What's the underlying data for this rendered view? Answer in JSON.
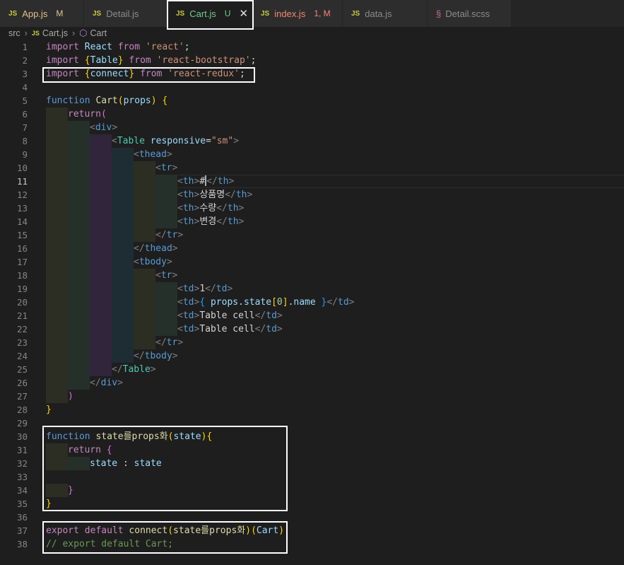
{
  "tabs": [
    {
      "icon": "JS",
      "label": "App.js",
      "badge": "M",
      "label_color": "#e2c08d",
      "badge_color": "#e2c08d"
    },
    {
      "icon": "JS",
      "label": "Detail.js",
      "badge": "",
      "label_color": "#8b8b8b",
      "badge_color": ""
    },
    {
      "icon": "JS",
      "label": "Cart.js",
      "badge": "U",
      "label_color": "#73c991",
      "badge_color": "#73c991",
      "active": true,
      "close": "✕"
    },
    {
      "icon": "JS",
      "label": "index.js",
      "badge": "1, M",
      "label_color": "#f48771",
      "badge_color": "#f48771"
    },
    {
      "icon": "JS",
      "label": "data.js",
      "badge": "",
      "label_color": "#8b8b8b",
      "badge_color": ""
    },
    {
      "icon": "sass-icon",
      "label": "Detail.scss",
      "badge": "",
      "label_color": "#8b8b8b",
      "badge_color": ""
    }
  ],
  "breadcrumb": {
    "folder": "src",
    "file_icon": "JS",
    "file": "Cart.js",
    "symbol_icon": "cube-icon",
    "symbol": "Cart"
  },
  "editor": {
    "current_line": 11,
    "lines": [
      {
        "n": "1",
        "indent": 0,
        "t": [
          [
            "import ",
            "kw"
          ],
          [
            "React ",
            "va"
          ],
          [
            "from ",
            "kw"
          ],
          [
            "'react'",
            "st"
          ],
          [
            ";",
            "txt"
          ]
        ]
      },
      {
        "n": "2",
        "indent": 0,
        "t": [
          [
            "import ",
            "kw"
          ],
          [
            "{",
            "br"
          ],
          [
            "Table",
            "va"
          ],
          [
            "} ",
            "br"
          ],
          [
            "from ",
            "kw"
          ],
          [
            "'react-bootstrap'",
            "st"
          ],
          [
            ";",
            "txt"
          ]
        ]
      },
      {
        "n": "3",
        "indent": 0,
        "t": [
          [
            "import ",
            "kw"
          ],
          [
            "{",
            "br"
          ],
          [
            "connect",
            "va"
          ],
          [
            "} ",
            "br"
          ],
          [
            "from ",
            "kw"
          ],
          [
            "'react-redux'",
            "st"
          ],
          [
            ";",
            "txt"
          ]
        ]
      },
      {
        "n": "4",
        "indent": 0,
        "t": []
      },
      {
        "n": "5",
        "indent": 0,
        "t": [
          [
            "function ",
            "dk"
          ],
          [
            "Cart",
            "fn"
          ],
          [
            "(",
            "br"
          ],
          [
            "props",
            "va"
          ],
          [
            ") ",
            "br"
          ],
          [
            "{",
            "br"
          ]
        ]
      },
      {
        "n": "6",
        "indent": 1,
        "t": [
          [
            "return",
            "kw"
          ],
          [
            "(",
            "bp"
          ]
        ]
      },
      {
        "n": "7",
        "indent": 2,
        "t": [
          [
            "<",
            "tg"
          ],
          [
            "div",
            "dk"
          ],
          [
            ">",
            "tg"
          ]
        ]
      },
      {
        "n": "8",
        "indent": 3,
        "t": [
          [
            "<",
            "tg"
          ],
          [
            "Table ",
            "cl"
          ],
          [
            "responsive",
            "va"
          ],
          [
            "=",
            "txt"
          ],
          [
            "\"sm\"",
            "st"
          ],
          [
            ">",
            "tg"
          ]
        ]
      },
      {
        "n": "9",
        "indent": 4,
        "t": [
          [
            "<",
            "tg"
          ],
          [
            "thead",
            "dk"
          ],
          [
            ">",
            "tg"
          ]
        ]
      },
      {
        "n": "10",
        "indent": 5,
        "t": [
          [
            "<",
            "tg"
          ],
          [
            "tr",
            "dk"
          ],
          [
            ">",
            "tg"
          ]
        ]
      },
      {
        "n": "11",
        "indent": 6,
        "t": [
          [
            "<",
            "tg"
          ],
          [
            "th",
            "dk"
          ],
          [
            ">",
            "tg"
          ],
          [
            "#",
            "txt"
          ],
          [
            "|CURSOR|",
            "cur"
          ],
          [
            "</",
            "tg"
          ],
          [
            "th",
            "dk"
          ],
          [
            ">",
            "tg"
          ]
        ]
      },
      {
        "n": "12",
        "indent": 6,
        "t": [
          [
            "<",
            "tg"
          ],
          [
            "th",
            "dk"
          ],
          [
            ">",
            "tg"
          ],
          [
            "상품명",
            "txt"
          ],
          [
            "</",
            "tg"
          ],
          [
            "th",
            "dk"
          ],
          [
            ">",
            "tg"
          ]
        ]
      },
      {
        "n": "13",
        "indent": 6,
        "t": [
          [
            "<",
            "tg"
          ],
          [
            "th",
            "dk"
          ],
          [
            ">",
            "tg"
          ],
          [
            "수량",
            "txt"
          ],
          [
            "</",
            "tg"
          ],
          [
            "th",
            "dk"
          ],
          [
            ">",
            "tg"
          ]
        ]
      },
      {
        "n": "14",
        "indent": 6,
        "t": [
          [
            "<",
            "tg"
          ],
          [
            "th",
            "dk"
          ],
          [
            ">",
            "tg"
          ],
          [
            "변경",
            "txt"
          ],
          [
            "</",
            "tg"
          ],
          [
            "th",
            "dk"
          ],
          [
            ">",
            "tg"
          ]
        ]
      },
      {
        "n": "15",
        "indent": 5,
        "t": [
          [
            "</",
            "tg"
          ],
          [
            "tr",
            "dk"
          ],
          [
            ">",
            "tg"
          ]
        ]
      },
      {
        "n": "16",
        "indent": 4,
        "t": [
          [
            "</",
            "tg"
          ],
          [
            "thead",
            "dk"
          ],
          [
            ">",
            "tg"
          ]
        ]
      },
      {
        "n": "17",
        "indent": 4,
        "t": [
          [
            "<",
            "tg"
          ],
          [
            "tbody",
            "dk"
          ],
          [
            ">",
            "tg"
          ]
        ]
      },
      {
        "n": "18",
        "indent": 5,
        "t": [
          [
            "<",
            "tg"
          ],
          [
            "tr",
            "dk"
          ],
          [
            ">",
            "tg"
          ]
        ]
      },
      {
        "n": "19",
        "indent": 6,
        "t": [
          [
            "<",
            "tg"
          ],
          [
            "td",
            "dk"
          ],
          [
            ">",
            "tg"
          ],
          [
            "1",
            "txt"
          ],
          [
            "</",
            "tg"
          ],
          [
            "td",
            "dk"
          ],
          [
            ">",
            "tg"
          ]
        ]
      },
      {
        "n": "20",
        "indent": 6,
        "t": [
          [
            "<",
            "tg"
          ],
          [
            "td",
            "dk"
          ],
          [
            ">",
            "tg"
          ],
          [
            "{ ",
            "bb"
          ],
          [
            "props",
            "va"
          ],
          [
            ".",
            "txt"
          ],
          [
            "state",
            "va"
          ],
          [
            "[",
            "br"
          ],
          [
            "0",
            "nm"
          ],
          [
            "]",
            "br"
          ],
          [
            ".",
            "txt"
          ],
          [
            "name ",
            "va"
          ],
          [
            "}",
            "bb"
          ],
          [
            "</",
            "tg"
          ],
          [
            "td",
            "dk"
          ],
          [
            ">",
            "tg"
          ]
        ]
      },
      {
        "n": "21",
        "indent": 6,
        "t": [
          [
            "<",
            "tg"
          ],
          [
            "td",
            "dk"
          ],
          [
            ">",
            "tg"
          ],
          [
            "Table cell",
            "txt"
          ],
          [
            "</",
            "tg"
          ],
          [
            "td",
            "dk"
          ],
          [
            ">",
            "tg"
          ]
        ]
      },
      {
        "n": "22",
        "indent": 6,
        "t": [
          [
            "<",
            "tg"
          ],
          [
            "td",
            "dk"
          ],
          [
            ">",
            "tg"
          ],
          [
            "Table cell",
            "txt"
          ],
          [
            "</",
            "tg"
          ],
          [
            "td",
            "dk"
          ],
          [
            ">",
            "tg"
          ]
        ]
      },
      {
        "n": "23",
        "indent": 5,
        "t": [
          [
            "</",
            "tg"
          ],
          [
            "tr",
            "dk"
          ],
          [
            ">",
            "tg"
          ]
        ]
      },
      {
        "n": "24",
        "indent": 4,
        "t": [
          [
            "</",
            "tg"
          ],
          [
            "tbody",
            "dk"
          ],
          [
            ">",
            "tg"
          ]
        ]
      },
      {
        "n": "25",
        "indent": 3,
        "t": [
          [
            "</",
            "tg"
          ],
          [
            "Table",
            "cl"
          ],
          [
            ">",
            "tg"
          ]
        ]
      },
      {
        "n": "26",
        "indent": 2,
        "t": [
          [
            "</",
            "tg"
          ],
          [
            "div",
            "dk"
          ],
          [
            ">",
            "tg"
          ]
        ]
      },
      {
        "n": "27",
        "indent": 1,
        "t": [
          [
            ")",
            "bp"
          ]
        ]
      },
      {
        "n": "28",
        "indent": 0,
        "t": [
          [
            "}",
            "br"
          ]
        ]
      },
      {
        "n": "29",
        "indent": 0,
        "t": []
      },
      {
        "n": "30",
        "indent": 0,
        "t": [
          [
            "function ",
            "dk"
          ],
          [
            "state를props화",
            "fn"
          ],
          [
            "(",
            "br"
          ],
          [
            "state",
            "va"
          ],
          [
            ")",
            "br"
          ],
          [
            "{",
            "br"
          ]
        ]
      },
      {
        "n": "31",
        "indent": 1,
        "t": [
          [
            "return ",
            "kw"
          ],
          [
            "{",
            "bp"
          ]
        ]
      },
      {
        "n": "32",
        "indent": 2,
        "t": [
          [
            "state ",
            "va"
          ],
          [
            ": ",
            "txt"
          ],
          [
            "state",
            "va"
          ]
        ]
      },
      {
        "n": "33",
        "indent": 0,
        "t": []
      },
      {
        "n": "34",
        "indent": 1,
        "t": [
          [
            "}",
            "bp"
          ]
        ]
      },
      {
        "n": "35",
        "indent": 0,
        "t": [
          [
            "}",
            "br"
          ]
        ]
      },
      {
        "n": "36",
        "indent": 0,
        "t": []
      },
      {
        "n": "37",
        "indent": 0,
        "t": [
          [
            "export ",
            "kw"
          ],
          [
            "default ",
            "kw"
          ],
          [
            "connect",
            "fn"
          ],
          [
            "(",
            "br"
          ],
          [
            "state를props화",
            "fn"
          ],
          [
            ")",
            "br"
          ],
          [
            "(",
            "br"
          ],
          [
            "Cart",
            "va"
          ],
          [
            ")",
            "br"
          ]
        ]
      },
      {
        "n": "38",
        "indent": 0,
        "t": [
          [
            "// export default Cart;",
            "cm"
          ]
        ]
      }
    ]
  },
  "colors": {
    "editor_bg": "#1e1e1e",
    "tab_bar_bg": "#252526",
    "annotation_box": "#ffffff",
    "guide_levels": [
      "#2d2e23",
      "#25302a",
      "#30253a",
      "#1e2d33",
      "#2d2e23",
      "#25302a"
    ]
  }
}
